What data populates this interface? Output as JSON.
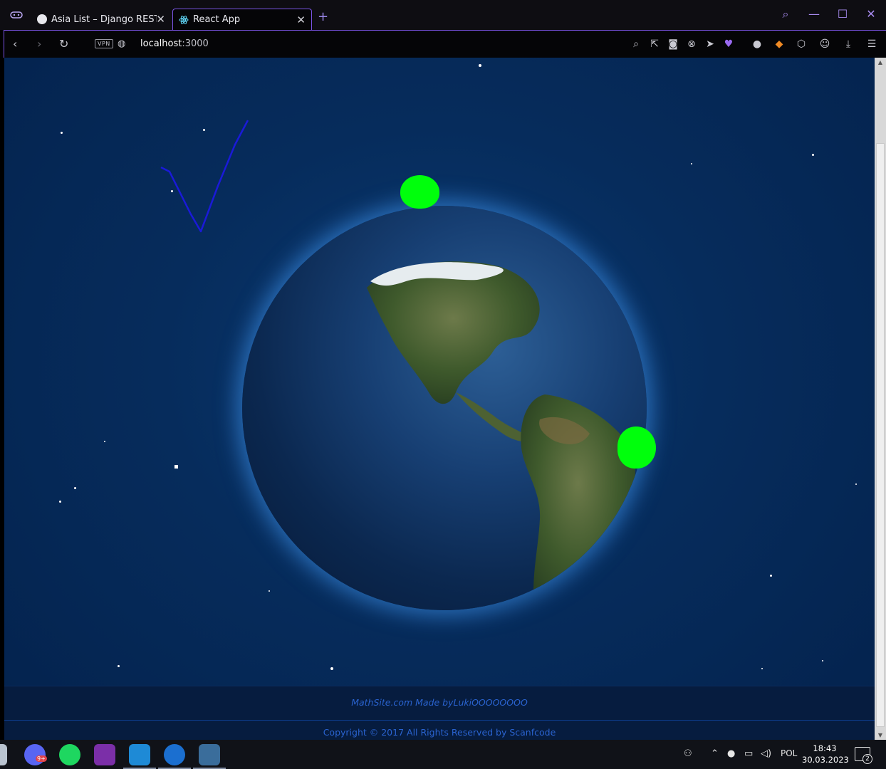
{
  "browser": {
    "tabs": [
      {
        "title": "Asia List – Django REST fra",
        "close": "✕"
      },
      {
        "title": "React App",
        "close": "✕"
      }
    ],
    "new_tab": "+",
    "vpn_label": "VPN",
    "url_host": "localhost",
    "url_port": ":3000",
    "window_controls": {
      "search": "⌕",
      "minimize": "—",
      "maximize": "☐",
      "close": "✕"
    },
    "toolbar_icons": [
      "search-page-icon",
      "share-icon",
      "camera-icon",
      "adblock-icon",
      "send-icon",
      "heart-icon",
      "extension-status-icon",
      "metamask-icon",
      "cube-icon",
      "profile-icon",
      "download-icon",
      "menu-icon"
    ]
  },
  "page": {
    "footer": {
      "made_by": "MathSite.com Made byLukiOOOOOOOO",
      "copyright": "Copyright © 2017 All Rights Reserved by Scanfcode"
    },
    "colors": {
      "background": "#04224d",
      "marker": "#00ff0c",
      "footer_text": "#2a63cf"
    }
  },
  "taskbar": {
    "apps": [
      "discord-icon",
      "spotify-icon",
      "onenote-icon",
      "vscode-icon",
      "bing-icon",
      "mysql-workbench-icon"
    ],
    "discord_badge": "9+",
    "language": "POL",
    "time": "18:43",
    "date": "30.03.2023",
    "notification_count": "2"
  }
}
